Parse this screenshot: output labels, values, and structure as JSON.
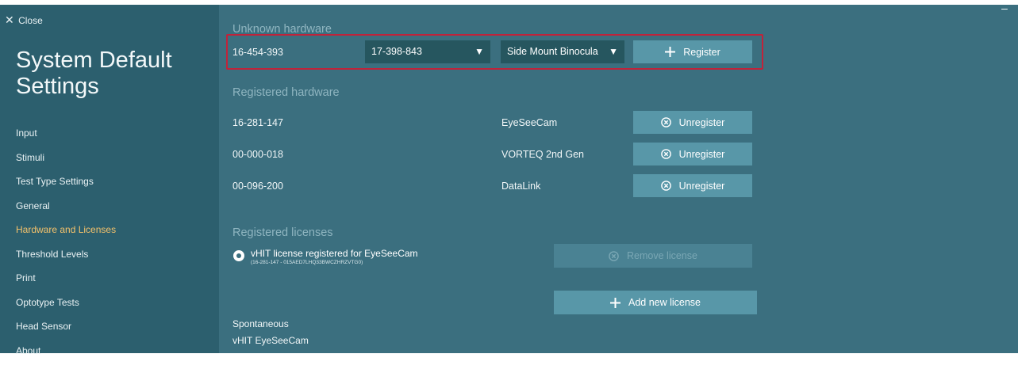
{
  "sidebar": {
    "close_label": "Close",
    "title_line1": "System Default",
    "title_line2": "Settings",
    "items": [
      {
        "label": "Input",
        "active": false
      },
      {
        "label": "Stimuli",
        "active": false
      },
      {
        "label": "Test Type Settings",
        "active": false
      },
      {
        "label": "General",
        "active": false
      },
      {
        "label": "Hardware and Licenses",
        "active": true
      },
      {
        "label": "Threshold Levels",
        "active": false
      },
      {
        "label": "Print",
        "active": false
      },
      {
        "label": "Optotype Tests",
        "active": false
      },
      {
        "label": "Head Sensor",
        "active": false
      },
      {
        "label": "About",
        "active": false
      }
    ]
  },
  "window_minimize": "–",
  "unknown_hardware": {
    "label": "Unknown hardware",
    "serial": "16-454-393",
    "dropdown_serial": "17-398-843",
    "dropdown_device": "Side Mount Binocula",
    "register_label": "Register"
  },
  "registered_hardware": {
    "label": "Registered hardware",
    "rows": [
      {
        "serial": "16-281-147",
        "device": "EyeSeeCam",
        "button": "Unregister"
      },
      {
        "serial": "00-000-018",
        "device": "VORTEQ 2nd Gen",
        "button": "Unregister"
      },
      {
        "serial": "00-096-200",
        "device": "DataLink",
        "button": "Unregister"
      }
    ]
  },
  "registered_licenses": {
    "label": "Registered licenses",
    "license_title": "vHIT license registered for EyeSeeCam",
    "license_sub": "(16-281-147 - 015AED7LHQ33BWCZHRZVTG0)",
    "remove_label": "Remove license",
    "add_label": "Add new license"
  },
  "modules": [
    "Spontaneous",
    "vHIT EyeSeeCam"
  ],
  "colors": {
    "sidebar_bg": "#2c5f6e",
    "main_bg": "#3b6f7f",
    "button_bg": "#5897a8",
    "active_nav": "#f5c26b",
    "highlight_border": "#c0233a"
  }
}
